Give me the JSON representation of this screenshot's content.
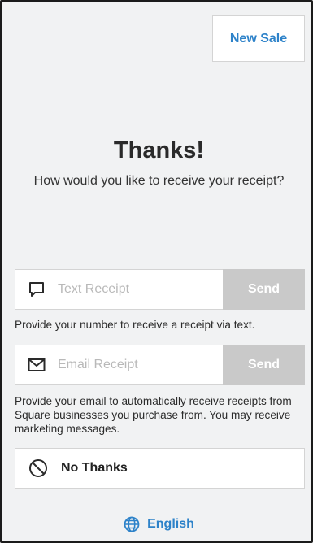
{
  "header": {
    "new_sale_label": "New Sale"
  },
  "main": {
    "title": "Thanks!",
    "subtitle": "How would you like to receive your receipt?"
  },
  "text_receipt": {
    "placeholder": "Text Receipt",
    "value": "",
    "send_label": "Send",
    "hint": "Provide your number to receive a receipt via text.",
    "icon": "chat-bubble-icon"
  },
  "email_receipt": {
    "placeholder": "Email Receipt",
    "value": "",
    "send_label": "Send",
    "hint": "Provide your email to automatically receive receipts from Square businesses you purchase from. You may receive marketing messages.",
    "icon": "envelope-icon"
  },
  "no_thanks": {
    "label": "No Thanks",
    "icon": "prohibited-icon"
  },
  "language": {
    "label": "English",
    "icon": "globe-icon"
  },
  "colors": {
    "accent": "#2d82c9",
    "send_disabled_bg": "#c9c9c9",
    "background": "#f1f2f3"
  }
}
